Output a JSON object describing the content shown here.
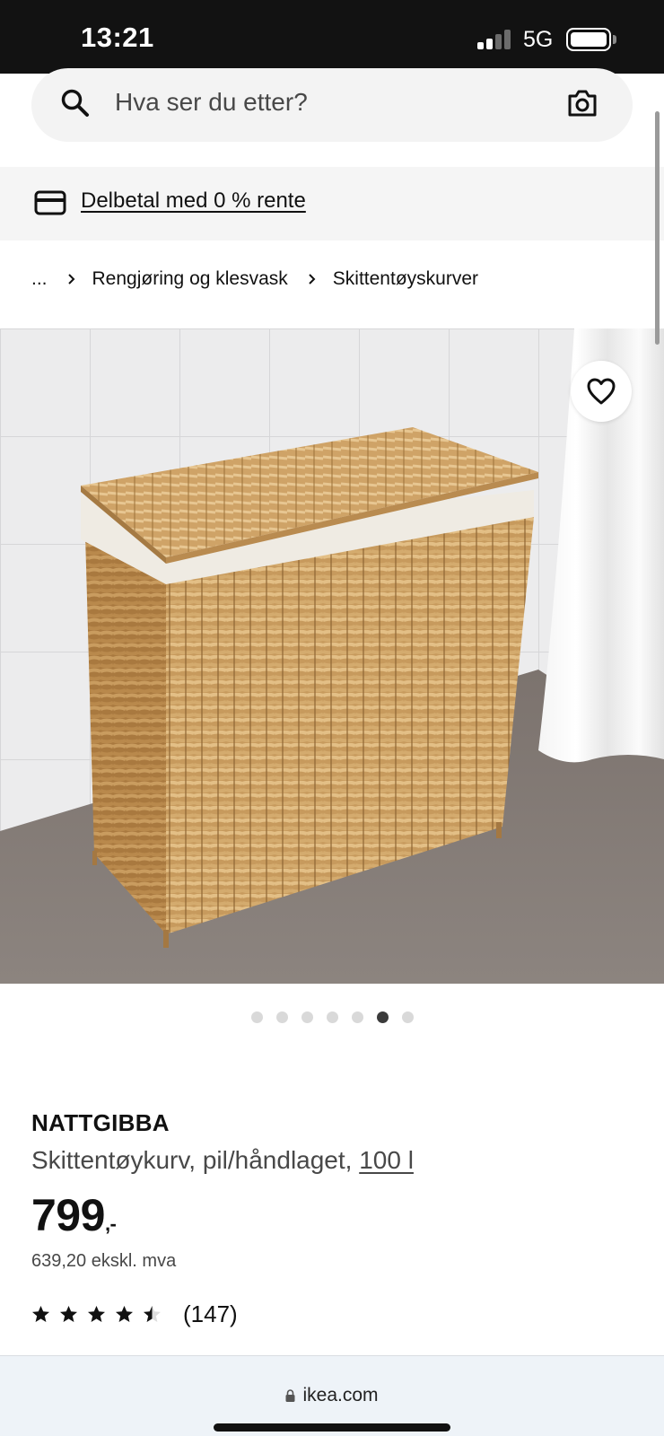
{
  "status_bar": {
    "time": "13:21",
    "network": "5G"
  },
  "search": {
    "placeholder": "Hva ser du etter?"
  },
  "finance_banner": {
    "link_text": "Delbetal med 0 % rente"
  },
  "breadcrumb": {
    "items": [
      "...",
      "Rengjøring og klesvask",
      "Skittentøyskurver"
    ]
  },
  "carousel": {
    "total": 7,
    "active_index": 5
  },
  "product": {
    "name": "NATTGIBBA",
    "description": "Skittentøykurv, pil/håndlaget,",
    "size_link": "100 l",
    "price": "799",
    "price_suffix": ",-",
    "price_ex_vat": "639,20 ekskl. mva",
    "rating": 4.5,
    "review_count": "(147)"
  },
  "browser": {
    "url": "ikea.com"
  },
  "colors": {
    "status_bar": "#121212",
    "search_bg": "#f3f3f3",
    "banner_bg": "#f5f5f5",
    "text": "#111111"
  }
}
